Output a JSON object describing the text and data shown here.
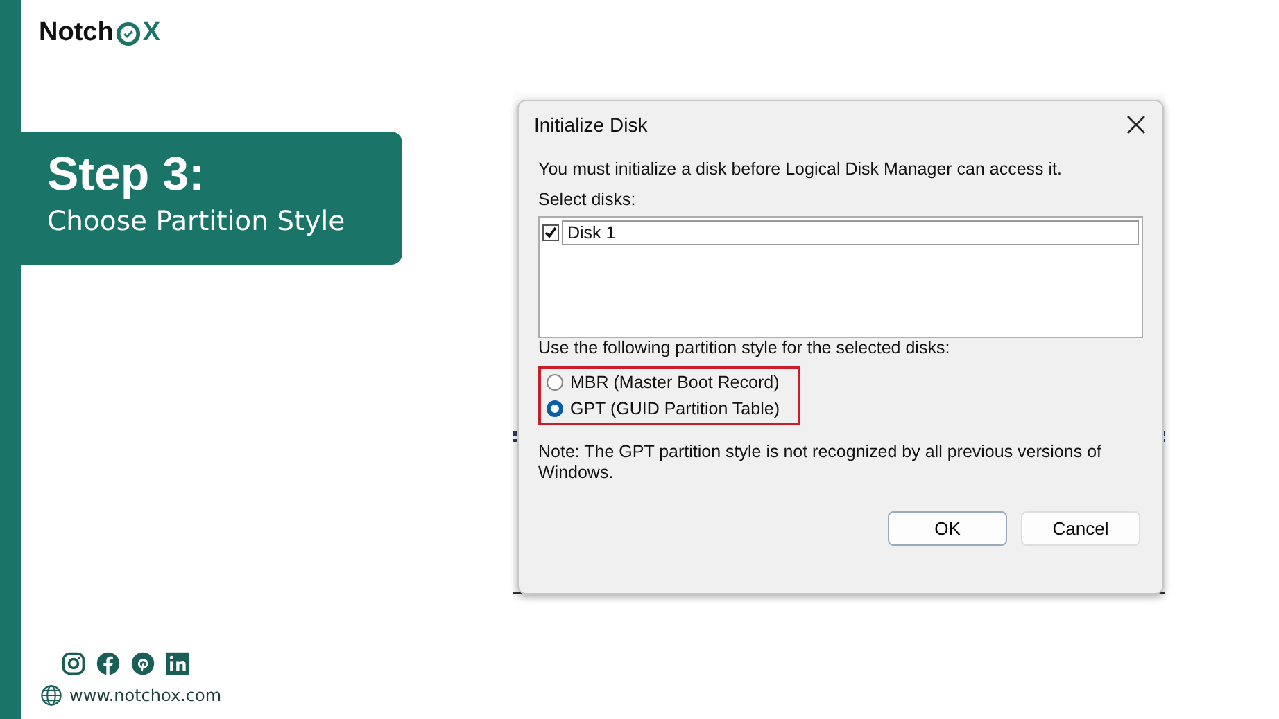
{
  "brand": {
    "prefix": "Notch",
    "suffix": "X"
  },
  "step": {
    "title": "Step 3:",
    "subtitle": "Choose Partition Style"
  },
  "dialog": {
    "title": "Initialize Disk",
    "intro": "You must initialize a disk before Logical Disk Manager can access it.",
    "select_label": "Select disks:",
    "disks": [
      {
        "label": "Disk 1",
        "checked": true
      }
    ],
    "style_label": "Use the following partition style for the selected disks:",
    "options": [
      {
        "label": "MBR (Master Boot Record)",
        "selected": false
      },
      {
        "label": "GPT (GUID Partition Table)",
        "selected": true
      }
    ],
    "note": "Note: The GPT partition style is not recognized by all previous versions of Windows.",
    "buttons": [
      {
        "label": "OK",
        "kind": "primary"
      },
      {
        "label": "Cancel",
        "kind": "secondary"
      }
    ]
  },
  "footer": {
    "socials": [
      {
        "kind": "instagram"
      },
      {
        "kind": "facebook"
      },
      {
        "kind": "pinterest"
      },
      {
        "kind": "linkedin"
      }
    ],
    "website": "www.notchox.com"
  }
}
